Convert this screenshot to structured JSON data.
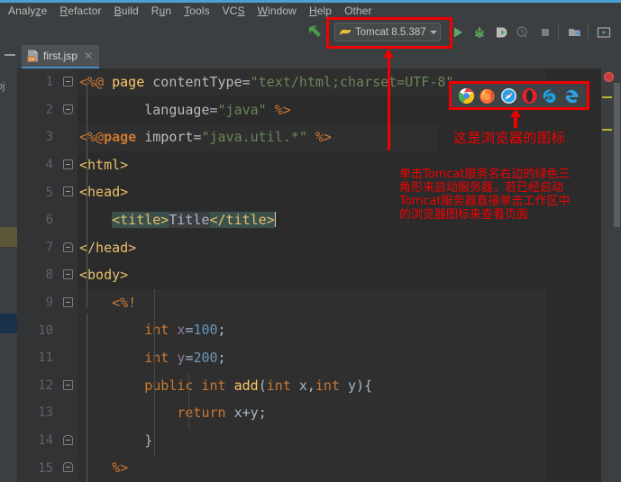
{
  "menubar": {
    "items": [
      {
        "label": "Analyze",
        "pre": "Analy",
        "mn": "z",
        "post": "e"
      },
      {
        "label": "Refactor",
        "pre": "",
        "mn": "R",
        "post": "efactor"
      },
      {
        "label": "Build",
        "pre": "",
        "mn": "B",
        "post": "uild"
      },
      {
        "label": "Run",
        "pre": "R",
        "mn": "u",
        "post": "n"
      },
      {
        "label": "Tools",
        "pre": "",
        "mn": "T",
        "post": "ools"
      },
      {
        "label": "VCS",
        "pre": "VC",
        "mn": "S",
        "post": ""
      },
      {
        "label": "Window",
        "pre": "",
        "mn": "W",
        "post": "indow"
      },
      {
        "label": "Help",
        "pre": "",
        "mn": "H",
        "post": "elp"
      },
      {
        "label": "Other",
        "pre": "Other",
        "mn": "",
        "post": ""
      }
    ]
  },
  "toolbar": {
    "run_config_label": "Tomcat 8.5.387",
    "tomcat_icon": "tomcat-icon",
    "dropdown_icon": "chevron-down-icon",
    "run_icon": "run-triangle-icon",
    "debug_icon": "debug-bug-icon",
    "coverage_icon": "run-with-coverage-icon",
    "profile_icon": "profiler-icon",
    "stop_icon": "stop-square-icon",
    "structure_icon": "project-structure-icon",
    "preview_icon": "preview-window-icon"
  },
  "tabs": {
    "active": "first.jsp",
    "file_icon": "jsp-file-icon",
    "close_icon": "close-icon"
  },
  "sidebar": {
    "project_label": "proj"
  },
  "editor": {
    "lines": [
      {
        "no": "1",
        "indent": 0
      },
      {
        "no": "2",
        "indent": 0
      },
      {
        "no": "3",
        "indent": 0
      },
      {
        "no": "4",
        "indent": 0
      },
      {
        "no": "5",
        "indent": 0
      },
      {
        "no": "6",
        "indent": 0
      },
      {
        "no": "7",
        "indent": 0
      },
      {
        "no": "8",
        "indent": 0
      },
      {
        "no": "9",
        "indent": 0
      },
      {
        "no": "10",
        "indent": 0
      },
      {
        "no": "11",
        "indent": 0
      },
      {
        "no": "12",
        "indent": 0
      },
      {
        "no": "13",
        "indent": 0
      },
      {
        "no": "14",
        "indent": 0
      },
      {
        "no": "15",
        "indent": 0
      }
    ],
    "code_text": {
      "l1": "<%@ page contentType=\"text/html;charset=UTF-8\"",
      "l2": "        language=\"java\" %>",
      "l3": "<%@page import=\"java.util.*\" %>",
      "l4": "<html>",
      "l5": "<head>",
      "l6": "    <title>Title</title>",
      "l7": "</head>",
      "l8": "<body>",
      "l9": "    <%!",
      "l10": "        int x=100;",
      "l11": "        int y=200;",
      "l12": "        public int add(int x,int y){",
      "l13": "            return x+y;",
      "l14": "        }",
      "l15": "    %>"
    }
  },
  "browser_bar": {
    "icons": [
      {
        "name": "chrome-icon",
        "label": "Chrome"
      },
      {
        "name": "firefox-icon",
        "label": "Firefox"
      },
      {
        "name": "safari-icon",
        "label": "Safari"
      },
      {
        "name": "opera-icon",
        "label": "Opera"
      },
      {
        "name": "ie-icon",
        "label": "Internet Explorer"
      },
      {
        "name": "edge-icon",
        "label": "Edge"
      }
    ]
  },
  "annotations": {
    "color": "#f40000",
    "browser_caption": "这是浏览器的图标",
    "tomcat_caption_l1": "单击Tomcat服务名右边的绿色三",
    "tomcat_caption_l2": "角形来启动服务器，若已经启动",
    "tomcat_caption_l3": "Tomcat服务器直接单击工作区中",
    "tomcat_caption_l4": "的浏览器图标来查看页面"
  }
}
